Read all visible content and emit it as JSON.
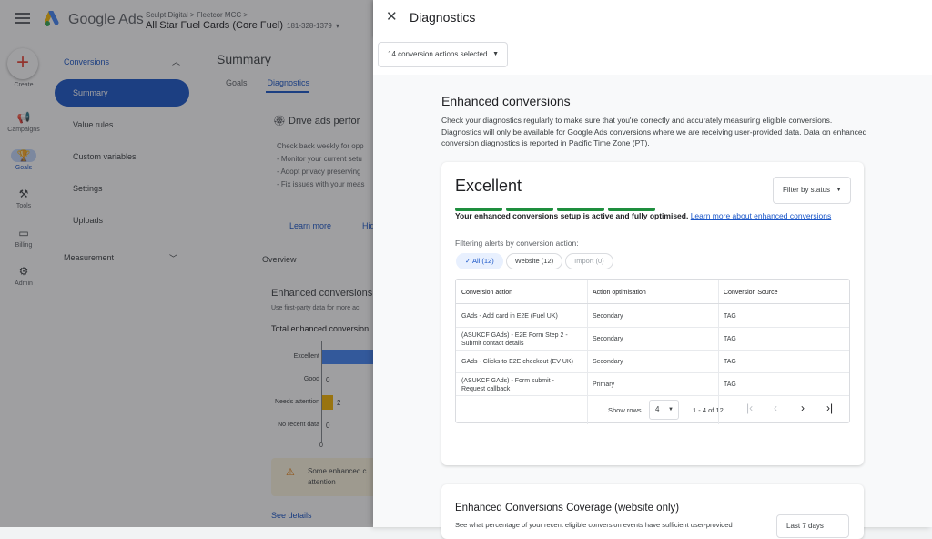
{
  "app": {
    "brand": "Google Ads",
    "breadcrumb": "Sculpt Digital  >  Fleetcor MCC  >",
    "account_name": "All Star Fuel Cards (Core Fuel)",
    "account_id": "181-328-1379"
  },
  "rail": {
    "create": "Create",
    "items": [
      {
        "label": "Campaigns",
        "icon": "campaigns-icon"
      },
      {
        "label": "Goals",
        "icon": "trophy-icon"
      },
      {
        "label": "Tools",
        "icon": "tools-icon"
      },
      {
        "label": "Billing",
        "icon": "billing-icon"
      },
      {
        "label": "Admin",
        "icon": "gear-icon"
      }
    ]
  },
  "sidebar": {
    "section": "Conversions",
    "items": [
      "Summary",
      "Value rules",
      "Custom variables",
      "Settings",
      "Uploads"
    ],
    "measurement": "Measurement"
  },
  "main": {
    "title": "Summary",
    "tabs": [
      "Goals",
      "Diagnostics"
    ],
    "promo_title": "Drive ads perfor",
    "promo_lines": [
      "Check back weekly for opp",
      "- Monitor your current setu",
      "- Adopt privacy preserving",
      "- Fix issues with your meas"
    ],
    "learn_more": "Learn more",
    "hide": "Hid",
    "overview": "Overview",
    "ec_title": "Enhanced conversions",
    "ec_sub": "Use first-party data for more ac",
    "ec_total": "Total enhanced conversion",
    "bars": [
      {
        "label": "Excellent",
        "value": "",
        "color": "#4285f4"
      },
      {
        "label": "Good",
        "value": "0",
        "color": ""
      },
      {
        "label": "Needs attention",
        "value": "2",
        "color": "#f4b400"
      },
      {
        "label": "No recent data",
        "value": "0",
        "color": ""
      }
    ],
    "axis_zero": "0",
    "warn_text": "Some enhanced c attention",
    "see_details": "See details"
  },
  "panel": {
    "title": "Diagnostics",
    "selector": "14 conversion actions selected",
    "section_title": "Enhanced conversions",
    "section_desc": "Check your diagnostics regularly to make sure that you're correctly and accurately measuring eligible conversions. Diagnostics will only be available for Google Ads conversions where we are receiving user-provided data. Data on enhanced conversion diagnostics is reported in Pacific Time Zone (PT).",
    "status_title": "Excellent",
    "filter_status": "Filter by status",
    "status_msg": "Your enhanced conversions setup is active and fully optimised.",
    "status_link": "Learn more about enhanced conversions",
    "filtering_label": "Filtering alerts by conversion action:",
    "chips": [
      "All (12)",
      "Website (12)",
      "Import (0)"
    ],
    "table": {
      "headers": [
        "Conversion action",
        "Action optimisation",
        "Conversion Source"
      ],
      "rows": [
        [
          "GAds - Add card in E2E (Fuel UK)",
          "Secondary",
          "TAG"
        ],
        [
          "(ASUKCF GAds) - E2E Form Step 2 - Submit contact details",
          "Secondary",
          "TAG"
        ],
        [
          "GAds - Clicks to E2E checkout (EV UK)",
          "Secondary",
          "TAG"
        ],
        [
          "(ASUKCF GAds) - Form submit - Request callback",
          "Primary",
          "TAG"
        ]
      ]
    },
    "pagination": {
      "show_rows": "Show rows",
      "rows_value": "4",
      "range": "1 - 4 of 12"
    },
    "coverage_title": "Enhanced Conversions Coverage (website only)",
    "coverage_desc": "See what percentage of your recent eligible conversion events have sufficient user-provided",
    "coverage_range": "Last 7 days"
  }
}
